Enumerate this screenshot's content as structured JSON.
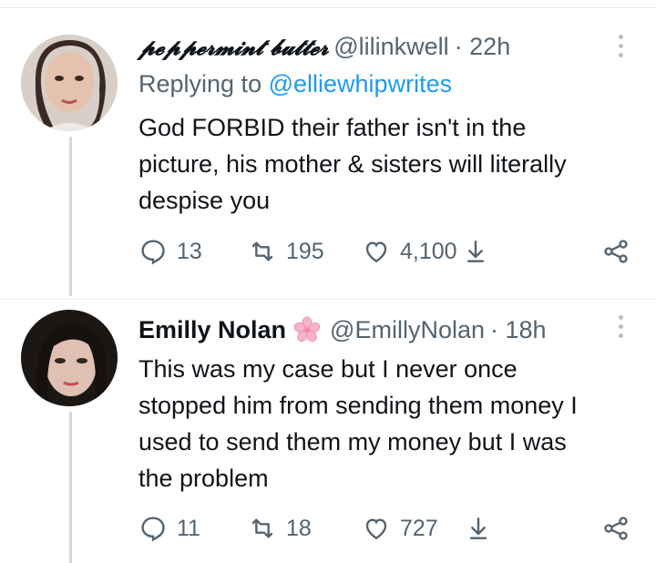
{
  "tweets": [
    {
      "display_name": "𝓹𝓮𝓹𝓹𝓮𝓻𝓶𝓲𝓷𝓽 𝓫𝓾𝓽𝓽𝓮𝓻",
      "handle": "@lilinkwell",
      "time": "· 22h",
      "replying_prefix": "Replying to",
      "replying_to": "@elliewhipwrites",
      "text_lines": [
        "God FORBID their father isn't in the",
        "picture, his mother & sisters will literally",
        "despise you"
      ],
      "replies": "13",
      "retweets": "195",
      "likes": "4,100"
    },
    {
      "display_name": "Emilly Nolan",
      "name_emoji": "cherry-blossom-icon",
      "handle": "@EmillyNolan",
      "time": "· 18h",
      "text_lines": [
        "This was my case but I never once",
        "stopped him from sending them money I",
        "used to send them my money but I was",
        "the problem"
      ],
      "replies": "11",
      "retweets": "18",
      "likes": "727"
    }
  ],
  "colors": {
    "text": "#0f1419",
    "secondary": "#536471",
    "link": "#1d9bf0",
    "thread_line": "#cfd9de"
  }
}
